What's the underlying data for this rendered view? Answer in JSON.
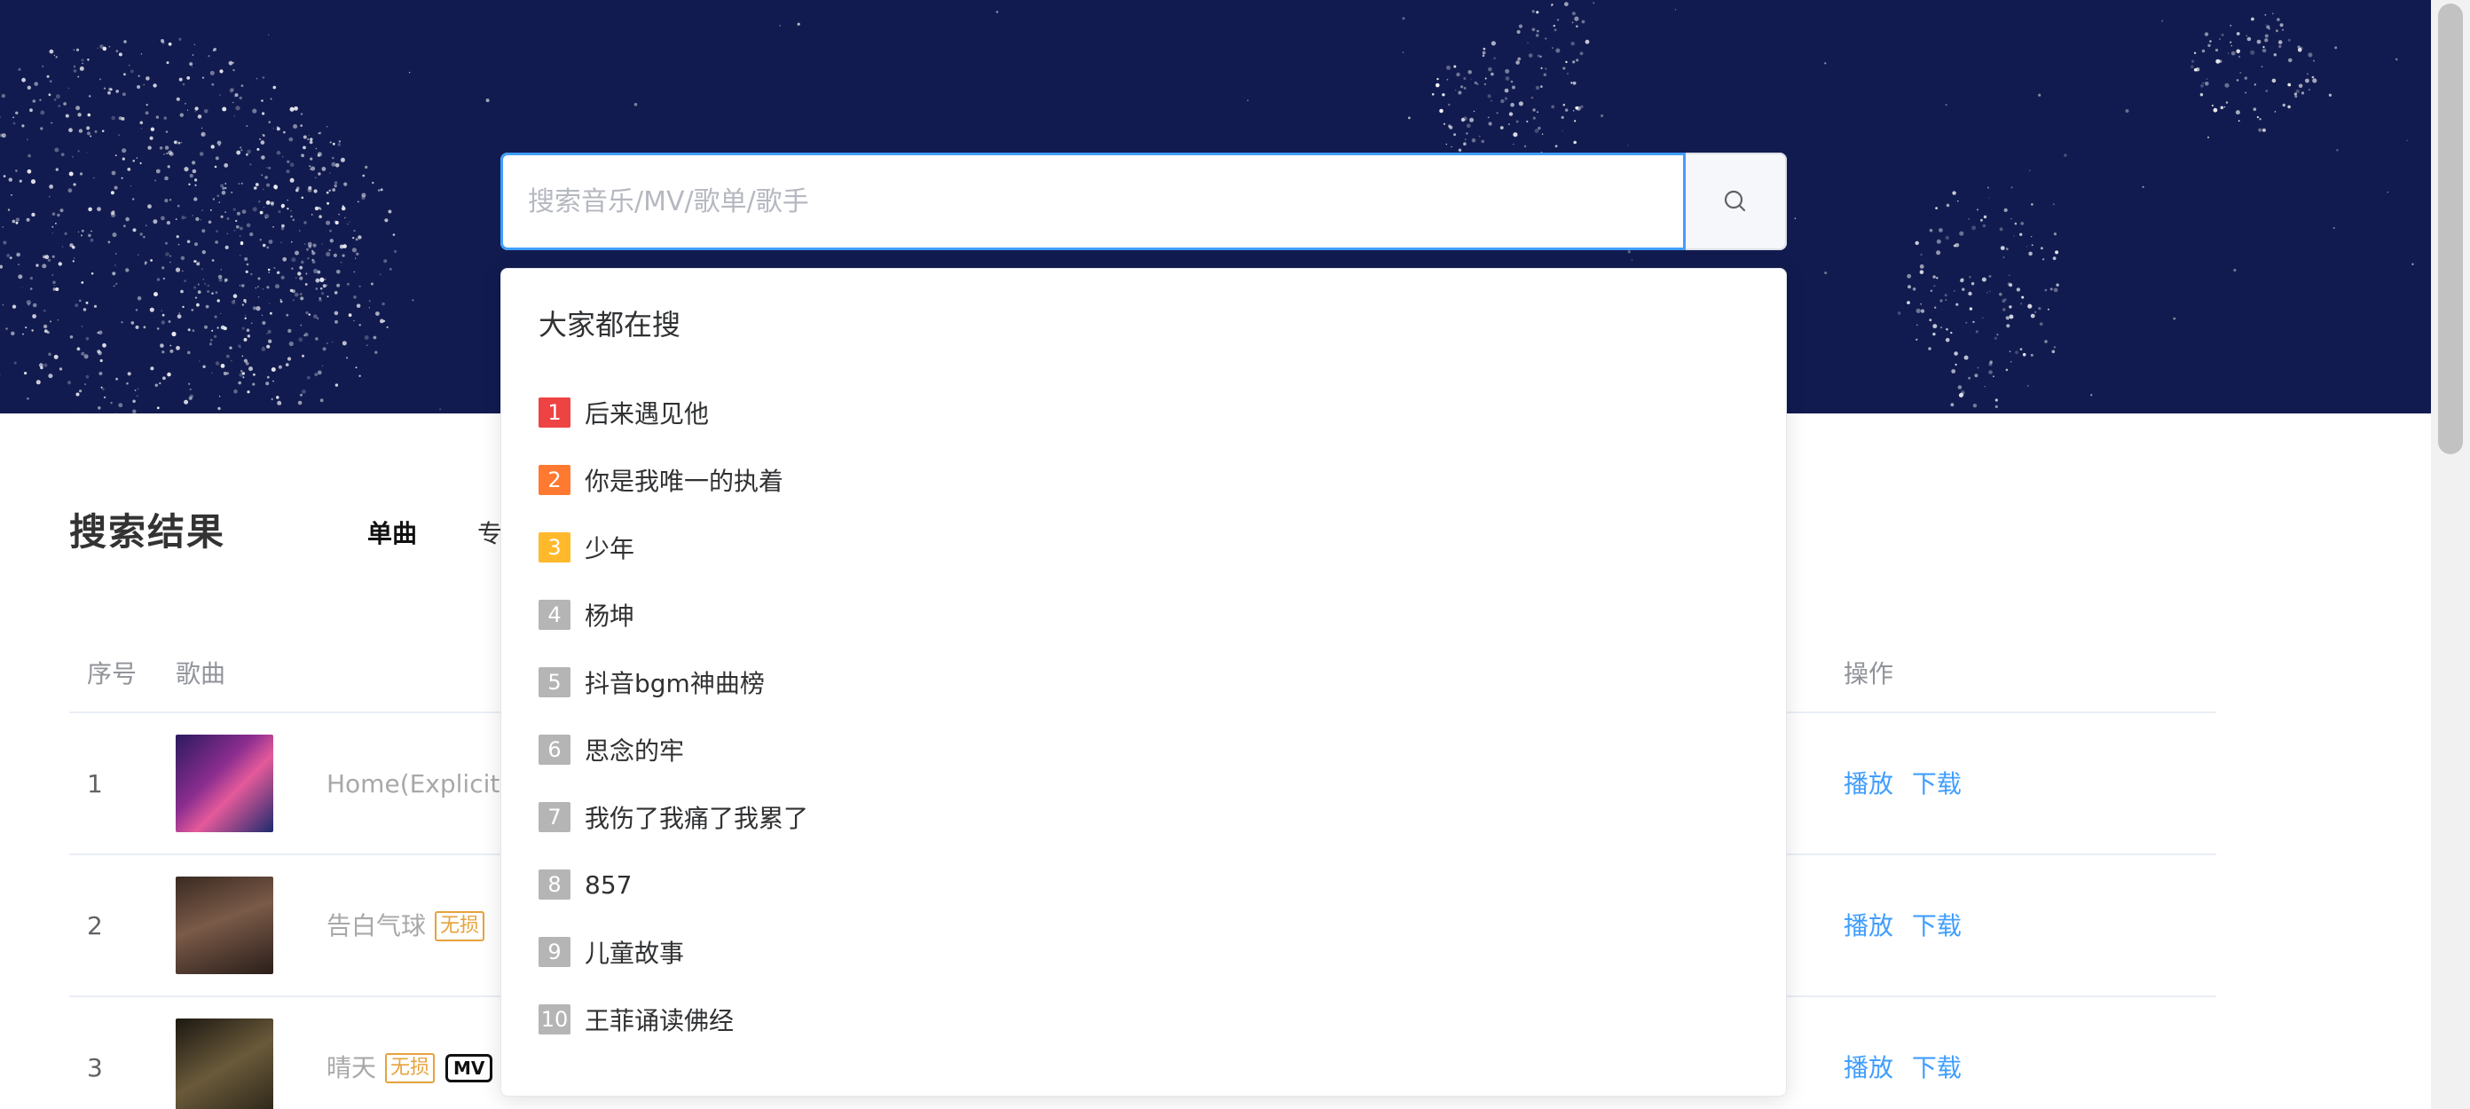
{
  "search": {
    "placeholder": "搜索音乐/MV/歌单/歌手"
  },
  "results": {
    "title": "搜索结果",
    "tabs": [
      {
        "label": "单曲",
        "active": true
      },
      {
        "label": "专",
        "active": false
      }
    ],
    "columns": {
      "index": "序号",
      "song": "歌曲",
      "actions": "操作"
    },
    "rows": [
      {
        "index": "1",
        "name": "Home(Explicit)",
        "badges": [
          "explicit"
        ],
        "play": "播放",
        "download": "下载"
      },
      {
        "index": "2",
        "name": "告白气球",
        "lossless": "无损",
        "play": "播放",
        "download": "下载"
      },
      {
        "index": "3",
        "name": "晴天",
        "lossless": "无损",
        "mv": "MV",
        "play": "播放",
        "download": "下载"
      }
    ]
  },
  "dropdown": {
    "title": "大家都在搜",
    "items": [
      {
        "rank": "1",
        "label": "后来遇见他",
        "color": "#ee4343"
      },
      {
        "rank": "2",
        "label": "你是我唯一的执着",
        "color": "#ff7a30"
      },
      {
        "rank": "3",
        "label": "少年",
        "color": "#ffb92a"
      },
      {
        "rank": "4",
        "label": "杨坤",
        "color": "#b5b5b5"
      },
      {
        "rank": "5",
        "label": "抖音bgm神曲榜",
        "color": "#b5b5b5"
      },
      {
        "rank": "6",
        "label": "思念的牢",
        "color": "#b5b5b5"
      },
      {
        "rank": "7",
        "label": "我伤了我痛了我累了",
        "color": "#b5b5b5"
      },
      {
        "rank": "8",
        "label": "857",
        "color": "#b5b5b5"
      },
      {
        "rank": "9",
        "label": "儿童故事",
        "color": "#b5b5b5"
      },
      {
        "rank": "10",
        "label": "王菲诵读佛经",
        "color": "#b5b5b5"
      }
    ]
  },
  "colors": {
    "hero": "#111b4f",
    "accent": "#409eff",
    "lossless": "#e6a23c"
  }
}
